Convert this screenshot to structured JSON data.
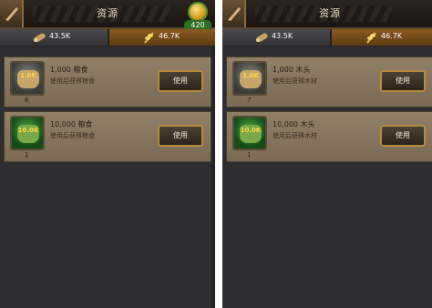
{
  "screens": [
    {
      "title": "资源",
      "gold": "420",
      "tabs": [
        {
          "label": "43.5K",
          "icon": "wood-log-icon"
        },
        {
          "label": "46.7K",
          "icon": "wheat-icon"
        }
      ],
      "items": [
        {
          "amount_label": "1.0K",
          "qty": "6",
          "name": "1,000 粮食",
          "desc": "使用后获得粮食",
          "button": "使用"
        },
        {
          "amount_label": "10.0K",
          "qty": "1",
          "name": "10,000 粮食",
          "desc": "使用后获得粮食",
          "button": "使用"
        }
      ]
    },
    {
      "title": "资源",
      "gold": "",
      "tabs": [
        {
          "label": "43.5K",
          "icon": "wood-log-icon"
        },
        {
          "label": "46.7K",
          "icon": "wheat-icon"
        }
      ],
      "items": [
        {
          "amount_label": "1.0K",
          "qty": "7",
          "name": "1,000 木头",
          "desc": "使用后获得木材",
          "button": "使用"
        },
        {
          "amount_label": "10.0K",
          "qty": "1",
          "name": "10,000 木头",
          "desc": "使用后获得木材",
          "button": "使用"
        }
      ]
    }
  ]
}
